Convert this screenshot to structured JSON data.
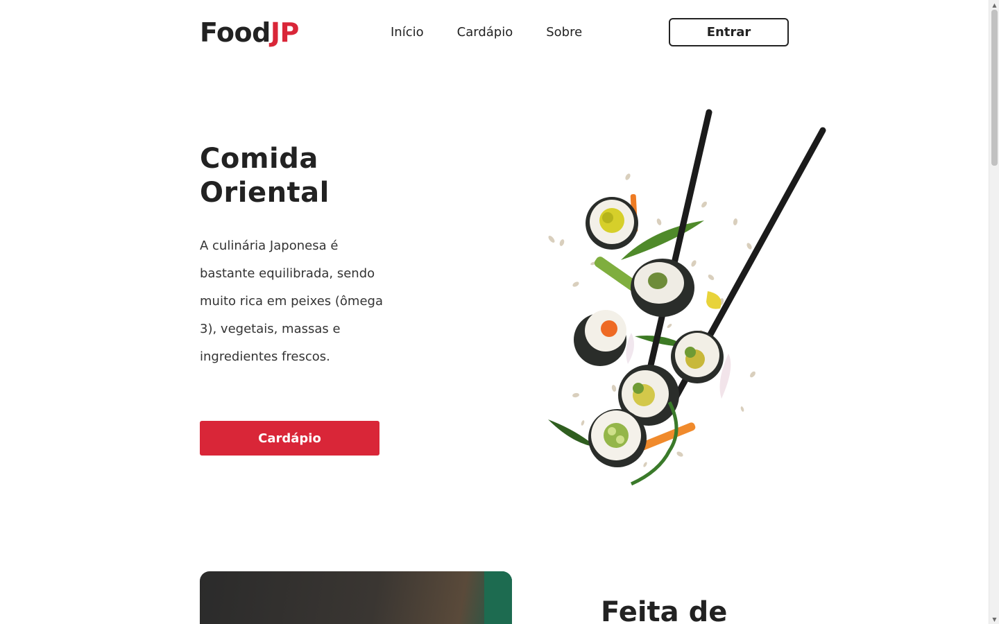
{
  "header": {
    "logo": {
      "main": "Food",
      "accent": "JP"
    },
    "nav": [
      {
        "label": "Início"
      },
      {
        "label": "Cardápio"
      },
      {
        "label": "Sobre"
      }
    ],
    "login_label": "Entrar"
  },
  "hero": {
    "title": "Comida Oriental",
    "description": "A culinária Japonesa é bastante equilibrada, sendo muito rica em peixes (ômega 3), vegetais, massas e ingredientes frescos.",
    "cta_label": "Cardápio"
  },
  "section2": {
    "title": "Feita de"
  },
  "colors": {
    "accent": "#d92638",
    "text": "#222222",
    "background": "#ffffff"
  },
  "icons": {
    "scroll_up": "triangle-up-icon",
    "scroll_down": "triangle-down-icon"
  }
}
